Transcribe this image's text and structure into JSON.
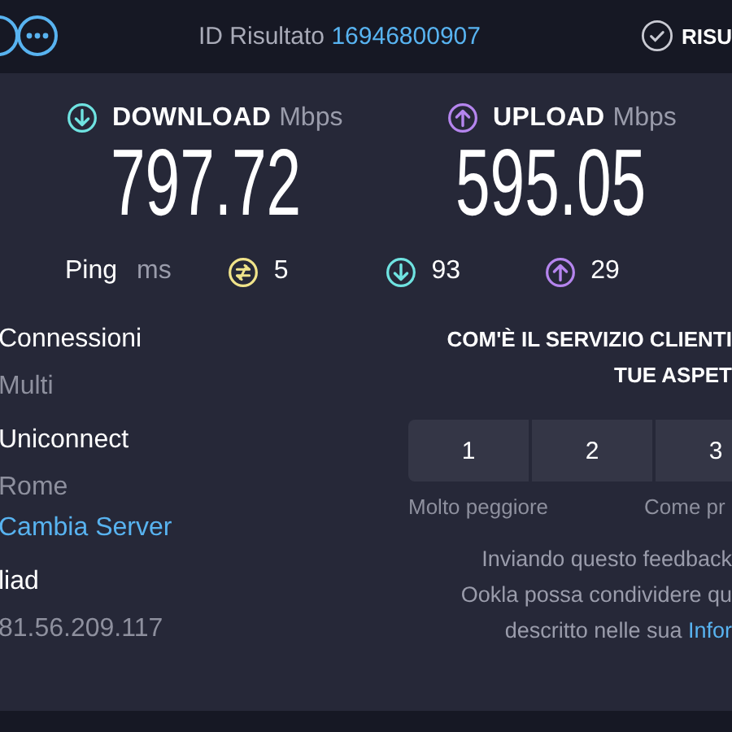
{
  "header": {
    "result_id_label": "ID Risultato",
    "result_id": "16946800907",
    "results_label": "RISU"
  },
  "speeds": [
    {
      "kind": "download",
      "label": "DOWNLOAD",
      "unit": "Mbps",
      "value": "797.72"
    },
    {
      "kind": "upload",
      "label": "UPLOAD",
      "unit": "Mbps",
      "value": "595.05"
    }
  ],
  "ping": {
    "label": "Ping",
    "unit": "ms",
    "items": [
      {
        "kind": "idle",
        "value": "5"
      },
      {
        "kind": "download",
        "value": "93"
      },
      {
        "kind": "upload",
        "value": "29"
      }
    ]
  },
  "server_info": [
    {
      "title": "Connessioni",
      "value": "Multi"
    },
    {
      "title": "Uniconnect",
      "value": "Rome",
      "link": "Cambia Server"
    },
    {
      "title": "liad",
      "value": "81.56.209.117"
    }
  ],
  "survey": {
    "question_lines": [
      "COM'È IL SERVIZIO CLIENTI",
      "TUE ASPET"
    ],
    "ratings": [
      "1",
      "2",
      "3"
    ],
    "scale_labels": [
      "Molto peggiore",
      "Come pr"
    ],
    "disclaimer_lines": [
      "Inviando questo feedback",
      "Ookla possa condividere qu",
      "descritto nelle sua"
    ],
    "disclaimer_link": "Infor"
  }
}
